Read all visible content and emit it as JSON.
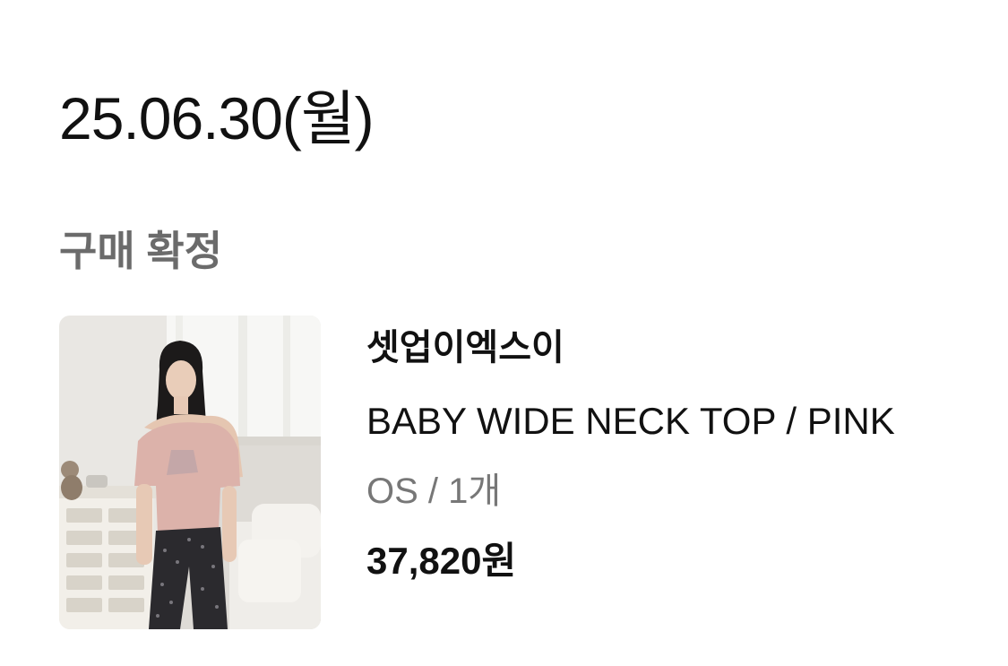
{
  "order": {
    "date": "25.06.30(월)",
    "status": "구매 확정"
  },
  "product": {
    "brand": "셋업이엑스이",
    "name": "BABY WIDE NECK TOP / PINK",
    "option": "OS / 1개",
    "price": "37,820원",
    "image_icon": "product-photo"
  },
  "colors": {
    "text_primary": "#111111",
    "text_secondary": "#777777",
    "status_text": "#6b6b6b",
    "background": "#ffffff"
  }
}
